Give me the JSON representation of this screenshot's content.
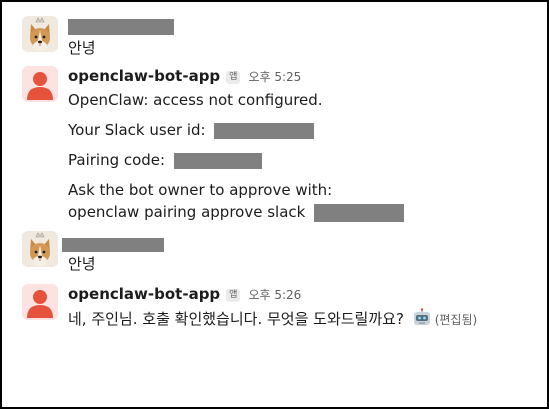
{
  "messages": [
    {
      "sender_redacted": true,
      "avatar": "corgi-crown-avatar",
      "lines": [
        "안녕"
      ]
    },
    {
      "sender": "openclaw-bot-app",
      "app_tag": "앱",
      "time": "오후 5:25",
      "avatar": "default-person-avatar",
      "intro": "OpenClaw: access not configured.",
      "user_id_label": "Your Slack user id:",
      "pairing_label": "Pairing code:",
      "instruction": "Ask the bot owner to approve with:",
      "command": "openclaw pairing approve slack"
    },
    {
      "sender_redacted": true,
      "avatar": "corgi-crown-avatar",
      "lines": [
        "안녕"
      ]
    },
    {
      "sender": "openclaw-bot-app",
      "app_tag": "앱",
      "time": "오후 5:26",
      "avatar": "default-person-avatar",
      "text": "네, 주인님. 호출 확인했습니다. 무엇을 도와드릴까요?",
      "emoji": "robot-face",
      "edited": "(편집됨)"
    }
  ],
  "colors": {
    "bot_avatar_bg": "#fce3e1",
    "bot_avatar_fg": "#e5533c",
    "redaction": "#808080",
    "muted_text": "#616061"
  }
}
